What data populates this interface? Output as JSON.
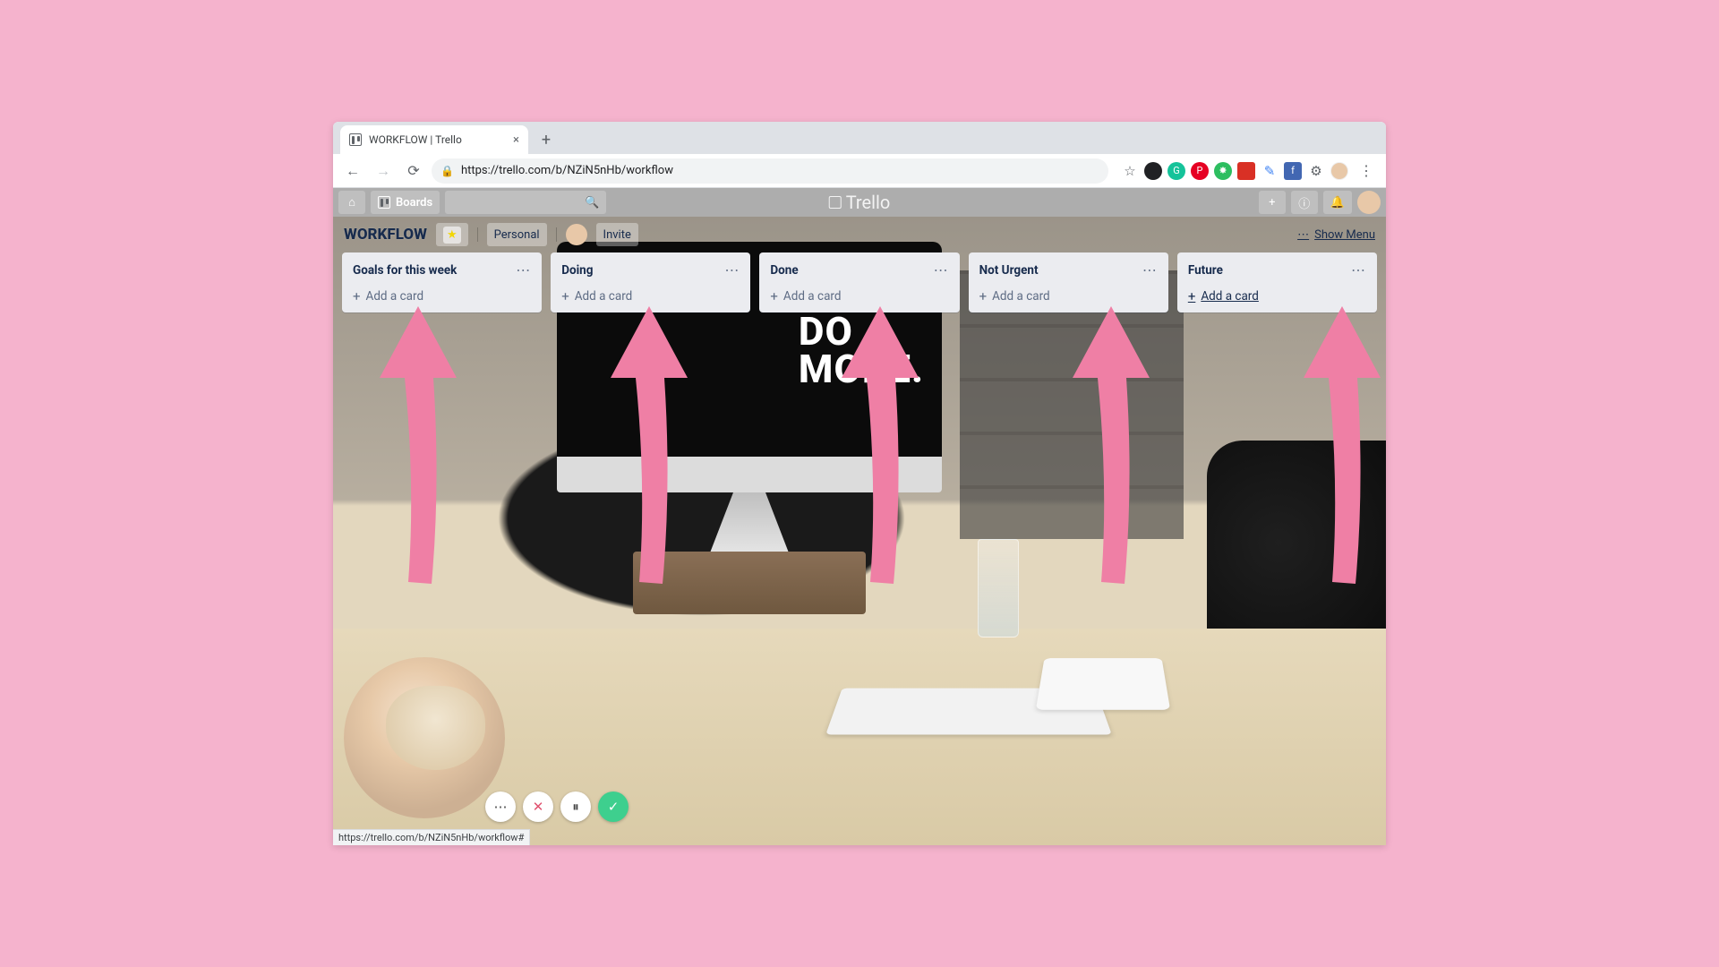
{
  "browser": {
    "tab_title": "WORKFLOW | Trello",
    "url": "https://trello.com/b/NZiN5nHb/workflow",
    "status_url": "https://trello.com/b/NZiN5nHb/workflow#"
  },
  "trello_header": {
    "home_label": "",
    "boards_label": "Boards",
    "logo_text": "Trello"
  },
  "board_header": {
    "title": "WORKFLOW",
    "visibility": "Personal",
    "invite_label": "Invite",
    "show_menu_label": "Show Menu"
  },
  "lists": [
    {
      "title": "Goals for this week",
      "add_label": "Add a card"
    },
    {
      "title": "Doing",
      "add_label": "Add a card"
    },
    {
      "title": "Done",
      "add_label": "Add a card"
    },
    {
      "title": "Not Urgent",
      "add_label": "Add a card"
    },
    {
      "title": "Future",
      "add_label": "Add a card"
    }
  ],
  "background_image_text": {
    "line1": "DO",
    "line2": "MORE."
  },
  "extension_icons": [
    {
      "name": "star-icon",
      "bg": "transparent",
      "glyph": "☆",
      "fg": "#5f6368"
    },
    {
      "name": "ext-circle-1",
      "bg": "#202124",
      "glyph": "",
      "fg": "#fff"
    },
    {
      "name": "grammarly-icon",
      "bg": "#15c39a",
      "glyph": "G",
      "fg": "#fff"
    },
    {
      "name": "pinterest-icon",
      "bg": "#e60023",
      "glyph": "P",
      "fg": "#fff"
    },
    {
      "name": "evernote-icon",
      "bg": "#2dbe60",
      "glyph": "✸",
      "fg": "#fff"
    },
    {
      "name": "ext-red-square",
      "bg": "#d93025",
      "glyph": "",
      "fg": "#fff"
    },
    {
      "name": "ext-pen-icon",
      "bg": "transparent",
      "glyph": "✎",
      "fg": "#4285f4"
    },
    {
      "name": "facebook-icon",
      "bg": "#4267B2",
      "glyph": "f",
      "fg": "#fff"
    },
    {
      "name": "settings-ext-icon",
      "bg": "transparent",
      "glyph": "⚙",
      "fg": "#5f6368"
    }
  ],
  "annotation": {
    "arrow_color": "#ef7fa5"
  }
}
